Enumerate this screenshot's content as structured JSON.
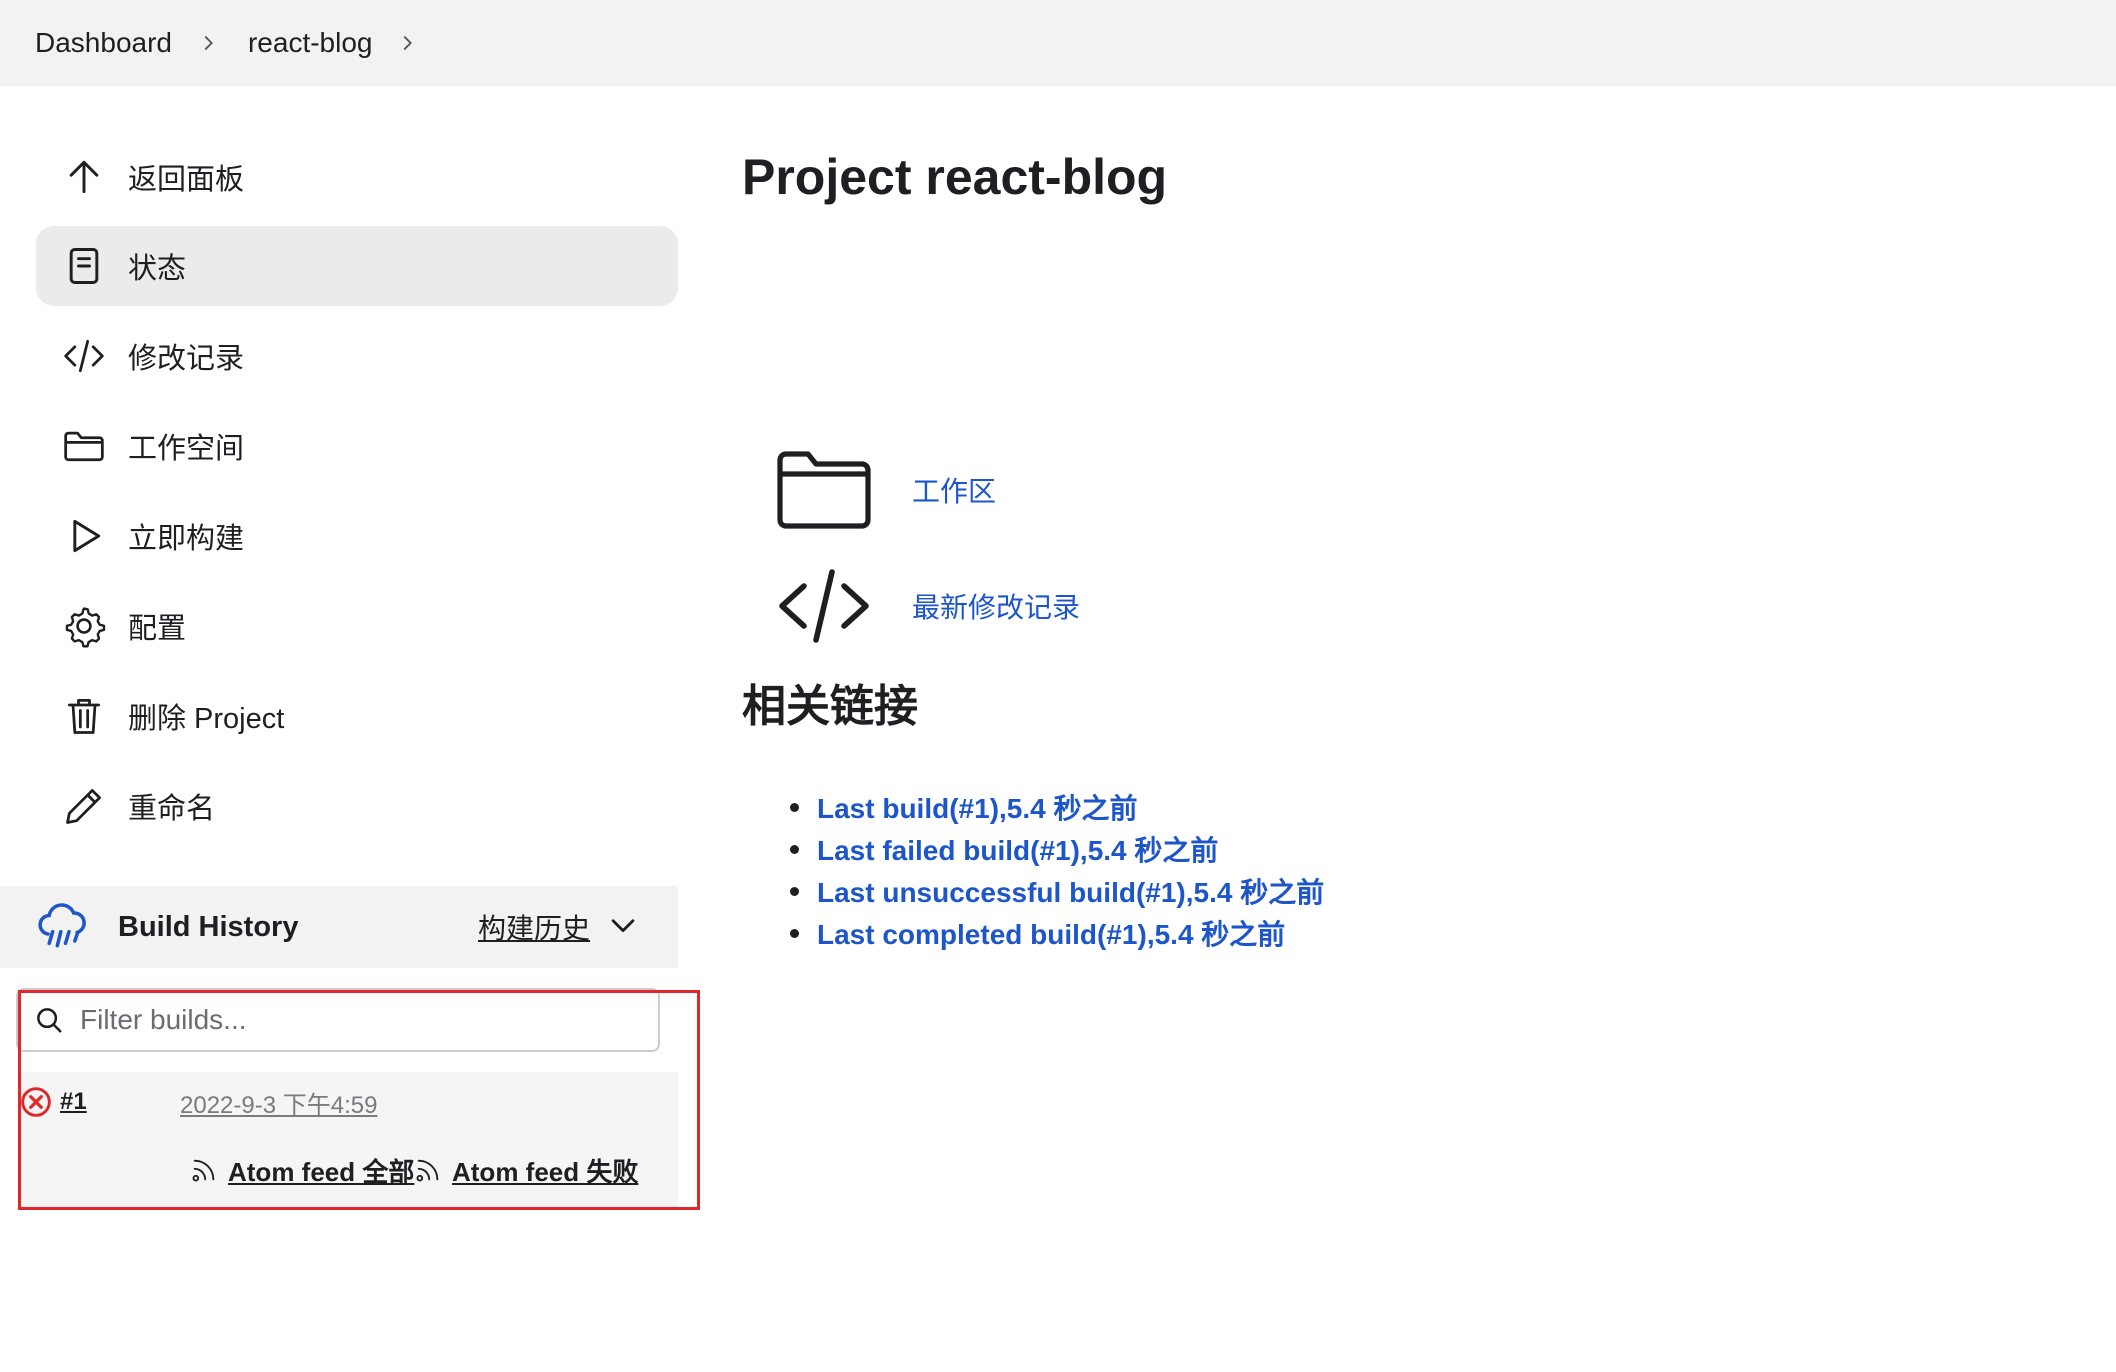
{
  "breadcrumb": {
    "items": [
      "Dashboard",
      "react-blog"
    ]
  },
  "sidebar": {
    "items": [
      {
        "label": "返回面板",
        "icon": "arrow-up-icon"
      },
      {
        "label": "状态",
        "icon": "document-icon",
        "active": true
      },
      {
        "label": "修改记录",
        "icon": "code-icon"
      },
      {
        "label": "工作空间",
        "icon": "folder-icon"
      },
      {
        "label": "立即构建",
        "icon": "play-icon"
      },
      {
        "label": "配置",
        "icon": "gear-icon"
      },
      {
        "label": "删除 Project",
        "icon": "trash-icon"
      },
      {
        "label": "重命名",
        "icon": "pencil-icon"
      }
    ]
  },
  "build_history": {
    "title": "Build History",
    "trend_label": "构建历史",
    "filter_placeholder": "Filter builds...",
    "builds": [
      {
        "number": "#1",
        "date": "2022-9-3 下午4:59",
        "status": "failed"
      }
    ],
    "feeds": {
      "all": "Atom feed 全部",
      "failed": "Atom feed 失败"
    }
  },
  "main": {
    "title": "Project react-blog",
    "workspace_link": "工作区",
    "changes_link": "最新修改记录",
    "related_title": "相关链接",
    "related_links": [
      "Last build(#1),5.4 秒之前",
      "Last failed build(#1),5.4 秒之前",
      "Last unsuccessful build(#1),5.4 秒之前",
      "Last completed build(#1),5.4 秒之前"
    ]
  },
  "colors": {
    "link": "#1d56c8",
    "active_bg": "#ebebeb",
    "header_bg": "#f2f2f2",
    "error": "#e0282a",
    "cloud": "#1d56c8"
  }
}
